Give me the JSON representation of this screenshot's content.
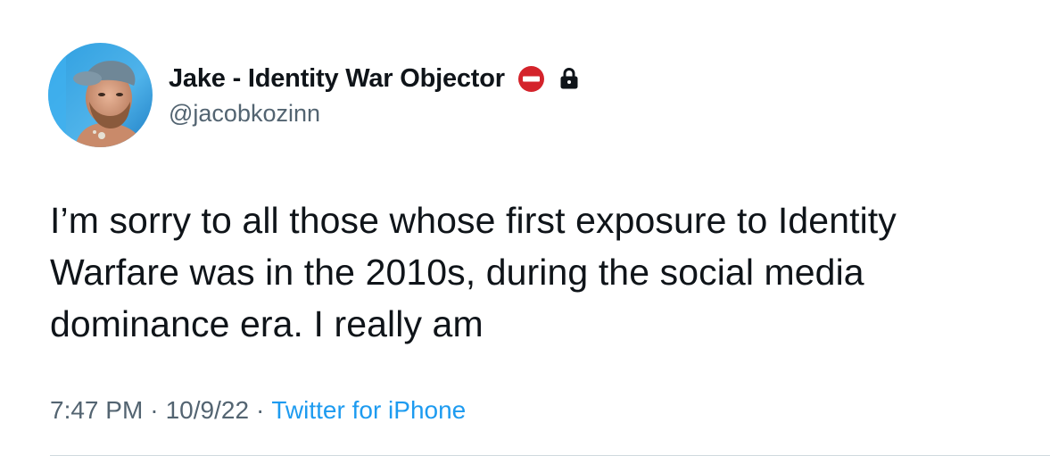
{
  "user": {
    "display_name": "Jake - Identity War Objector",
    "handle": "@jacobkozinn",
    "badge_icon": "no-entry-icon",
    "protected_icon": "lock-icon",
    "avatar": "profile-photo"
  },
  "tweet": {
    "text": "I’m sorry to all those whose first exposure to Identity\nWarfare was in the 2010s, during the social media\ndominance era. I really am",
    "time": "7:47 PM",
    "date": "10/9/22",
    "separator": "·",
    "source": "Twitter for iPhone"
  },
  "colors": {
    "text": "#0f1419",
    "secondary": "#536471",
    "link": "#1d9bf0",
    "badge_red": "#d4232b",
    "divider": "#cfd9de"
  }
}
